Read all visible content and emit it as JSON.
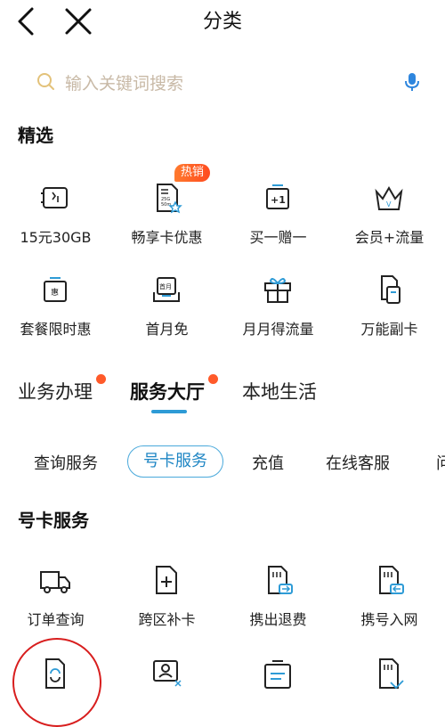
{
  "header": {
    "title": "分类"
  },
  "search": {
    "placeholder": "输入关键词搜索"
  },
  "featured": {
    "title": "精选",
    "hot_badge": "热销",
    "items": [
      {
        "label": "15元30GB"
      },
      {
        "label": "畅享卡优惠"
      },
      {
        "label": "买一赠一"
      },
      {
        "label": "会员+流量"
      },
      {
        "label": "套餐限时惠"
      },
      {
        "label": "首月免"
      },
      {
        "label": "月月得流量"
      },
      {
        "label": "万能副卡"
      }
    ]
  },
  "main_tabs": [
    {
      "label": "业务办理",
      "has_dot": true
    },
    {
      "label": "服务大厅",
      "has_dot": true,
      "active": true
    },
    {
      "label": "本地生活"
    }
  ],
  "sub_tabs": [
    {
      "label": "查询服务"
    },
    {
      "label": "号卡服务",
      "active": true
    },
    {
      "label": "充值"
    },
    {
      "label": "在线客服"
    },
    {
      "label": "问"
    }
  ],
  "card_service": {
    "title": "号卡服务",
    "items": [
      {
        "label": "订单查询"
      },
      {
        "label": "跨区补卡"
      },
      {
        "label": "携出退费"
      },
      {
        "label": "携号入网"
      }
    ]
  },
  "colors": {
    "accent": "#2e9bd6",
    "dot": "#ff5a2a",
    "badge": "#ff4b1f",
    "highlight_circle": "#d81e1e"
  }
}
